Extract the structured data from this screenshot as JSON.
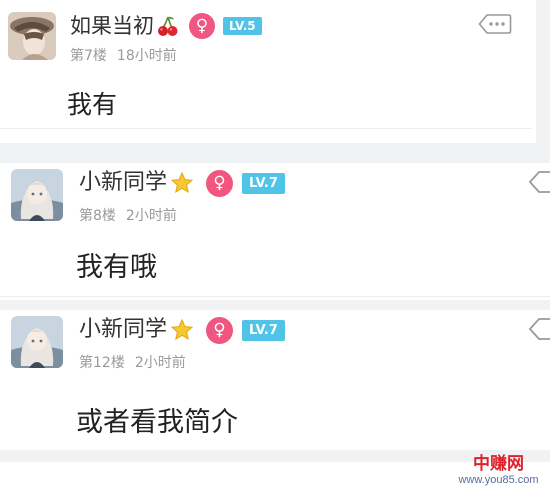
{
  "posts": [
    {
      "username": "如果当初",
      "deco_icon": "cherry-icon",
      "gender_icon": "female-icon",
      "gender_symbol": "♀",
      "level": "LV.5",
      "floor": "第7楼",
      "time": "18小时前",
      "content": "我有"
    },
    {
      "username": "小新同学",
      "deco_icon": "star-icon",
      "gender_icon": "female-icon",
      "gender_symbol": "♀",
      "level": "LV.7",
      "floor": "第8楼",
      "time": "2小时前",
      "content": "我有哦"
    },
    {
      "username": "小新同学",
      "deco_icon": "star-icon",
      "gender_icon": "female-icon",
      "gender_symbol": "♀",
      "level": "LV.7",
      "floor": "第12楼",
      "time": "2小时前",
      "content": "或者看我简介"
    }
  ],
  "colors": {
    "gender_female": "#f0567f",
    "level_badge": "#4fc3e8",
    "background": "#f1f2f4"
  },
  "watermark": {
    "title": "中赚网",
    "url": "www.you85.com"
  }
}
